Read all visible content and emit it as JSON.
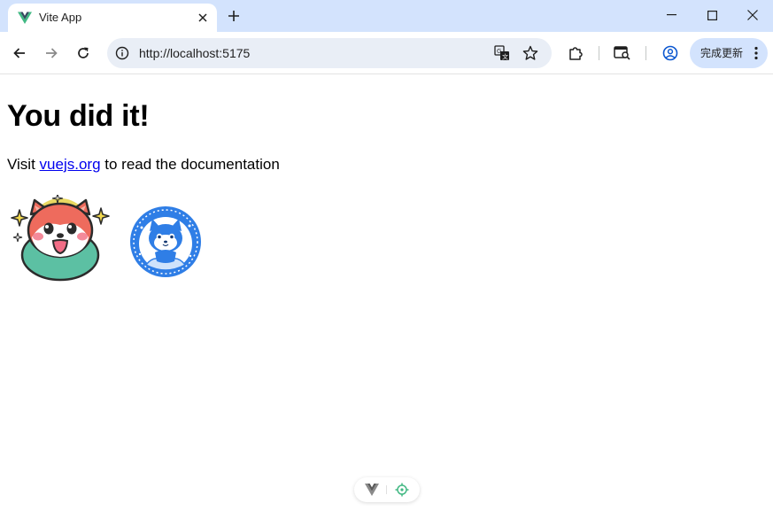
{
  "browser": {
    "tab": {
      "title": "Vite App",
      "favicon": "vue-logo-icon"
    },
    "url": "http://localhost:5175",
    "update_button_label": "完成更新",
    "colors": {
      "tabstrip": "#d3e3fd",
      "omnibox": "#e9eef6",
      "update_button": "#d3e3fd"
    }
  },
  "page": {
    "heading": "You did it!",
    "intro_prefix": "Visit ",
    "intro_link": "vuejs.org",
    "intro_suffix": " to read the documentation",
    "images": [
      {
        "name": "shiba-dog-logo"
      },
      {
        "name": "blue-cat-badge-logo"
      }
    ]
  },
  "devtools": {
    "icons": [
      "vue-devtools-icon",
      "inspect-target-icon"
    ],
    "accent": "#42b883"
  }
}
